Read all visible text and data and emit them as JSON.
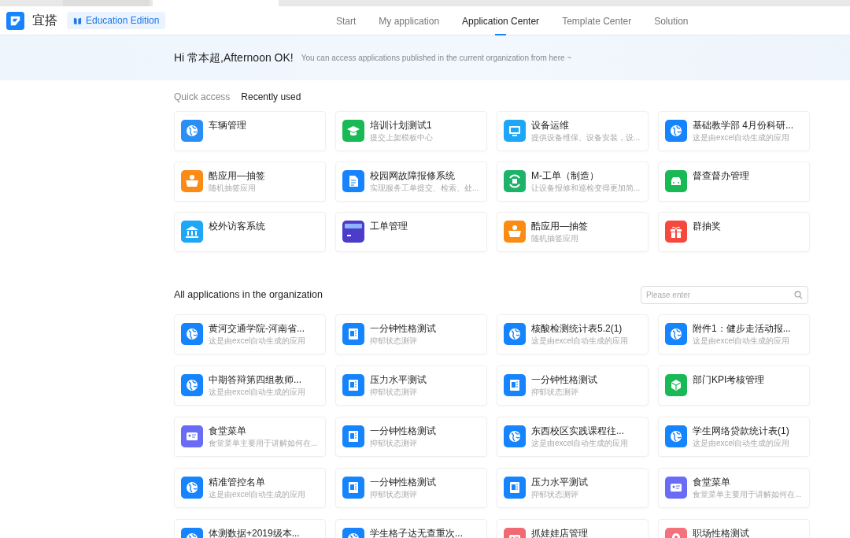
{
  "browser_tabs": [
    {
      "selected": false
    },
    {
      "selected": true
    }
  ],
  "header": {
    "app_name": "宜搭",
    "edition": "Education Edition"
  },
  "nav": [
    {
      "label": "Start",
      "selected": false
    },
    {
      "label": "My application",
      "selected": false
    },
    {
      "label": "Application Center",
      "selected": true
    },
    {
      "label": "Template Center",
      "selected": false
    },
    {
      "label": "Solution",
      "selected": false
    }
  ],
  "banner": {
    "greeting": "Hi 常本超,Afternoon OK!",
    "hint": "You can access applications published in the current organization from here ~"
  },
  "quick_tabs": [
    {
      "label": "Quick access",
      "selected": false
    },
    {
      "label": "Recently used",
      "selected": true
    }
  ],
  "recent_apps": [
    {
      "title": "车辆管理",
      "kind": "globe",
      "color": "#2b8ef7"
    },
    {
      "title": "培训计划测试1",
      "subtitle": "提交上架模板中心",
      "kind": "cap",
      "color": "#19b955"
    },
    {
      "title": "设备运维",
      "subtitle": "提供设备维保、设备安装，设...",
      "kind": "monitor",
      "color": "#1ea7f7"
    },
    {
      "title": "基础教学部 4月份科研...",
      "subtitle": "这是由excel自动生成的应用",
      "kind": "globe",
      "color": "#1684fc"
    },
    {
      "title": "酷应用—抽签",
      "subtitle": "随机抽签应用",
      "kind": "basket",
      "color": "#fa8c16"
    },
    {
      "title": "校园网故障报修系统",
      "subtitle": "实现服务工单提交、检索、处...",
      "kind": "doc",
      "color": "#1684fc"
    },
    {
      "title": "M-工单（制造）",
      "subtitle": "让设备报修和巡检变得更加简...",
      "kind": "cycle",
      "color": "#1db36b"
    },
    {
      "title": "督查督办管理",
      "kind": "car",
      "color": "#19b955"
    },
    {
      "title": "校外访客系统",
      "kind": "bank",
      "color": "#1ea7f7"
    },
    {
      "title": "工单管理",
      "kind": "ticket",
      "color": "#4b3cc9"
    },
    {
      "title": "酷应用—抽签",
      "subtitle": "随机抽签应用",
      "kind": "basket",
      "color": "#fa8c16"
    },
    {
      "title": "群抽奖",
      "kind": "gift",
      "color": "#f5493d"
    }
  ],
  "all_apps_section": {
    "title": "All applications in the organization",
    "search_placeholder": "Please enter",
    "items": [
      {
        "title": "黄河交通学院-河南省...",
        "subtitle": "这是由excel自动生成的应用",
        "kind": "globe",
        "color": "#1684fc"
      },
      {
        "title": "一分钟性格测试",
        "subtitle": "抑郁状态测评",
        "kind": "form",
        "color": "#1684fc"
      },
      {
        "title": "核酸检测统计表5.2(1)",
        "subtitle": "这是由excel自动生成的应用",
        "kind": "globe",
        "color": "#1684fc"
      },
      {
        "title": "附件1：健步走活动报...",
        "subtitle": "这是由excel自动生成的应用",
        "kind": "globe",
        "color": "#1684fc"
      },
      {
        "title": "中期答辩第四组教师...",
        "subtitle": "这是由excel自动生成的应用",
        "kind": "globe",
        "color": "#1684fc"
      },
      {
        "title": "压力水平测试",
        "subtitle": "抑郁状态测评",
        "kind": "form",
        "color": "#1684fc"
      },
      {
        "title": "一分钟性格测试",
        "subtitle": "抑郁状态测评",
        "kind": "form",
        "color": "#1684fc"
      },
      {
        "title": "部门KPI考核管理",
        "kind": "cube",
        "color": "#19b955"
      },
      {
        "title": "食堂菜单",
        "subtitle": "食堂菜单主要用于讲解如何在...",
        "kind": "card",
        "color": "#6b6cf6"
      },
      {
        "title": "一分钟性格测试",
        "subtitle": "抑郁状态测评",
        "kind": "form",
        "color": "#1684fc"
      },
      {
        "title": "东西校区实践课程往...",
        "subtitle": "这是由excel自动生成的应用",
        "kind": "globe",
        "color": "#1684fc"
      },
      {
        "title": "学生网络贷款统计表(1)",
        "subtitle": "这是由excel自动生成的应用",
        "kind": "globe",
        "color": "#1684fc"
      },
      {
        "title": "精准管控名单",
        "subtitle": "这是由excel自动生成的应用",
        "kind": "globe",
        "color": "#1684fc"
      },
      {
        "title": "一分钟性格测试",
        "subtitle": "抑郁状态测评",
        "kind": "form",
        "color": "#1684fc"
      },
      {
        "title": "压力水平测试",
        "subtitle": "抑郁状态测评",
        "kind": "form",
        "color": "#1684fc"
      },
      {
        "title": "食堂菜单",
        "subtitle": "食堂菜单主要用于讲解如何在...",
        "kind": "card",
        "color": "#6b6cf6"
      },
      {
        "title": "体测数据+2019级本...",
        "kind": "globe",
        "color": "#1684fc"
      },
      {
        "title": "学生格子达无查重次...",
        "kind": "globe",
        "color": "#1684fc"
      },
      {
        "title": "抓娃娃店管理",
        "kind": "card",
        "color": "#f06a74"
      },
      {
        "title": "职场性格测试",
        "kind": "pin",
        "color": "#f3727c"
      }
    ]
  }
}
